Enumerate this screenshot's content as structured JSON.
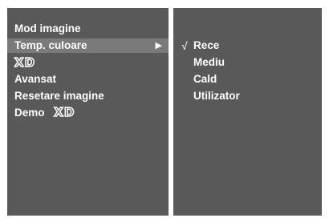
{
  "main_menu": {
    "items": [
      {
        "label": "Mod imagine"
      },
      {
        "label": "Temp. culoare",
        "selected": true,
        "arrow": "▶"
      },
      {
        "logo": "XD"
      },
      {
        "label": "Avansat"
      },
      {
        "label": "Resetare imagine"
      },
      {
        "label": "Demo",
        "logo": "XD"
      }
    ]
  },
  "submenu": {
    "items": [
      {
        "label": "Rece",
        "checked": true,
        "check_mark": "√"
      },
      {
        "label": "Mediu"
      },
      {
        "label": "Cald"
      },
      {
        "label": "Utilizator"
      }
    ]
  },
  "colors": {
    "panel": "#595959",
    "highlight": "#7a7a7a",
    "text": "#ffffff",
    "frame": "#ffffff"
  },
  "icons": {
    "submenu_arrow": "arrow-right-icon",
    "xd_logo": "xd-logo-icon",
    "check": "check-icon"
  }
}
